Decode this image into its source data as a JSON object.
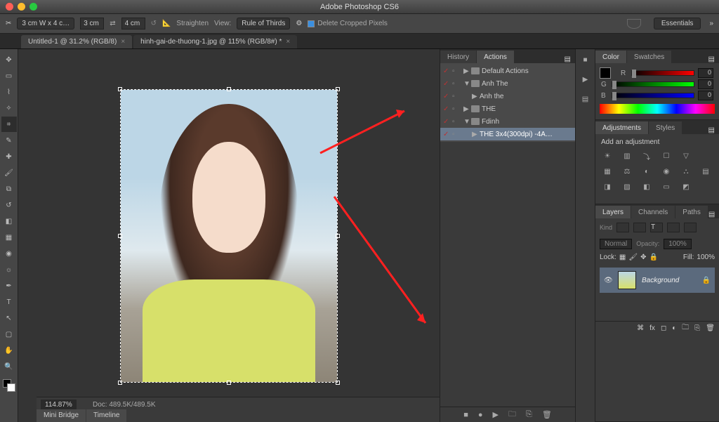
{
  "app_title": "Adobe Photoshop CS6",
  "workspace_selector": "Essentials",
  "options_bar": {
    "preset": "3 cm W x 4 c…",
    "width": "3 cm",
    "height": "4 cm",
    "straighten": "Straighten",
    "view_label": "View:",
    "view_value": "Rule of Thirds",
    "delete_cropped": "Delete Cropped Pixels"
  },
  "doc_tabs": [
    {
      "label": "Untitled-1 @ 31.2% (RGB/8)",
      "active": false
    },
    {
      "label": "hinh-gai-de-thuong-1.jpg @ 115% (RGB/8#) *",
      "active": true
    }
  ],
  "history_actions_tabs": {
    "history": "History",
    "actions": "Actions"
  },
  "actions": [
    {
      "indent": 0,
      "folder": true,
      "open": false,
      "label": "Default Actions",
      "checked": true
    },
    {
      "indent": 0,
      "folder": true,
      "open": true,
      "label": "Anh The",
      "checked": true
    },
    {
      "indent": 1,
      "folder": false,
      "open": false,
      "label": "Anh the",
      "checked": true
    },
    {
      "indent": 0,
      "folder": true,
      "open": false,
      "label": "THE",
      "checked": true
    },
    {
      "indent": 0,
      "folder": true,
      "open": true,
      "label": "Fdinh",
      "checked": true
    },
    {
      "indent": 1,
      "folder": false,
      "open": false,
      "label": "THE 3x4(300dpi) -4A…",
      "checked": true,
      "selected": true
    }
  ],
  "color_panel": {
    "tabs": {
      "color": "Color",
      "swatches": "Swatches"
    },
    "r": "0",
    "g": "0",
    "b": "0",
    "labels": {
      "r": "R",
      "g": "G",
      "b": "B"
    }
  },
  "adjustments_panel": {
    "tabs": {
      "adjustments": "Adjustments",
      "styles": "Styles"
    },
    "title": "Add an adjustment"
  },
  "layers_panel": {
    "tabs": {
      "layers": "Layers",
      "channels": "Channels",
      "paths": "Paths"
    },
    "kind": "Kind",
    "blend": "Normal",
    "opacity_label": "Opacity:",
    "opacity_value": "100%",
    "lock_label": "Lock:",
    "fill_label": "Fill:",
    "fill_value": "100%",
    "layer_name": "Background"
  },
  "status": {
    "zoom": "114.87%",
    "doc": "Doc: 489.5K/489.5K",
    "bottom_tabs": [
      "Mini Bridge",
      "Timeline"
    ]
  }
}
